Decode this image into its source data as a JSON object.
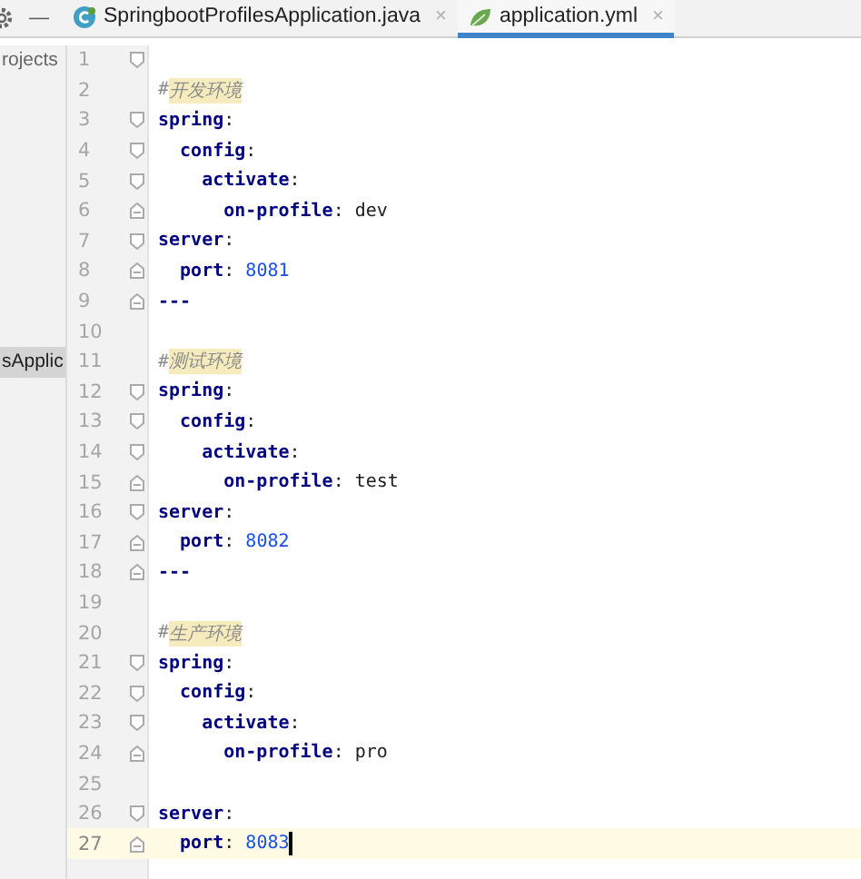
{
  "toolbar": {
    "minimize": "—"
  },
  "tabs": [
    {
      "label": "SpringbootProfilesApplication.java",
      "close": "×",
      "selected": false
    },
    {
      "label": "application.yml",
      "close": "×",
      "selected": true
    }
  ],
  "sidebar": {
    "items": [
      {
        "label": "rojects",
        "selected": false
      },
      {
        "label": "sApplic",
        "selected": true
      }
    ]
  },
  "editor": {
    "lines": [
      {
        "number": "1",
        "kind": "fold-start",
        "current": false
      },
      {
        "number": "2",
        "kind": "plain",
        "current": false,
        "tokens": [
          {
            "kind": "comment",
            "text": "#"
          },
          {
            "kind": "typo",
            "text": "开发环境"
          }
        ]
      },
      {
        "number": "3",
        "kind": "fold-start",
        "current": false,
        "tokens": [
          {
            "kind": "key",
            "text": "spring"
          },
          {
            "kind": "colon",
            "text": ":"
          }
        ]
      },
      {
        "number": "4",
        "kind": "fold-start",
        "current": false,
        "tokens": [
          {
            "kind": "key",
            "text": "  config"
          },
          {
            "kind": "colon",
            "text": ":"
          }
        ]
      },
      {
        "number": "5",
        "kind": "fold-start",
        "current": false,
        "tokens": [
          {
            "kind": "key",
            "text": "    activate"
          },
          {
            "kind": "colon",
            "text": ":"
          }
        ]
      },
      {
        "number": "6",
        "kind": "fold-end",
        "current": false,
        "tokens": [
          {
            "kind": "key",
            "text": "      on-profile"
          },
          {
            "kind": "colon",
            "text": ": "
          },
          {
            "kind": "value",
            "text": "dev"
          }
        ]
      },
      {
        "number": "7",
        "kind": "fold-start",
        "current": false,
        "tokens": [
          {
            "kind": "key",
            "text": "server"
          },
          {
            "kind": "colon",
            "text": ":"
          }
        ]
      },
      {
        "number": "8",
        "kind": "fold-end",
        "current": false,
        "tokens": [
          {
            "kind": "key",
            "text": "  port"
          },
          {
            "kind": "colon",
            "text": ": "
          },
          {
            "kind": "number",
            "text": "8081"
          }
        ]
      },
      {
        "number": "9",
        "kind": "fold-end",
        "current": false,
        "tokens": [
          {
            "kind": "doc",
            "text": "---"
          }
        ]
      },
      {
        "number": "10",
        "kind": "plain",
        "current": false
      },
      {
        "number": "11",
        "kind": "plain",
        "current": false,
        "tokens": [
          {
            "kind": "comment",
            "text": "#"
          },
          {
            "kind": "typo",
            "text": "测试环境"
          }
        ]
      },
      {
        "number": "12",
        "kind": "fold-start",
        "current": false,
        "tokens": [
          {
            "kind": "key",
            "text": "spring"
          },
          {
            "kind": "colon",
            "text": ":"
          }
        ]
      },
      {
        "number": "13",
        "kind": "fold-start",
        "current": false,
        "tokens": [
          {
            "kind": "key",
            "text": "  config"
          },
          {
            "kind": "colon",
            "text": ":"
          }
        ]
      },
      {
        "number": "14",
        "kind": "fold-start",
        "current": false,
        "tokens": [
          {
            "kind": "key",
            "text": "    activate"
          },
          {
            "kind": "colon",
            "text": ":"
          }
        ]
      },
      {
        "number": "15",
        "kind": "fold-end",
        "current": false,
        "tokens": [
          {
            "kind": "key",
            "text": "      on-profile"
          },
          {
            "kind": "colon",
            "text": ": "
          },
          {
            "kind": "value",
            "text": "test"
          }
        ]
      },
      {
        "number": "16",
        "kind": "fold-start",
        "current": false,
        "tokens": [
          {
            "kind": "key",
            "text": "server"
          },
          {
            "kind": "colon",
            "text": ":"
          }
        ]
      },
      {
        "number": "17",
        "kind": "fold-end",
        "current": false,
        "tokens": [
          {
            "kind": "key",
            "text": "  port"
          },
          {
            "kind": "colon",
            "text": ": "
          },
          {
            "kind": "number",
            "text": "8082"
          }
        ]
      },
      {
        "number": "18",
        "kind": "fold-end",
        "current": false,
        "tokens": [
          {
            "kind": "doc",
            "text": "---"
          }
        ]
      },
      {
        "number": "19",
        "kind": "plain",
        "current": false
      },
      {
        "number": "20",
        "kind": "plain",
        "current": false,
        "tokens": [
          {
            "kind": "comment",
            "text": "#"
          },
          {
            "kind": "typo",
            "text": "生产环境"
          }
        ]
      },
      {
        "number": "21",
        "kind": "fold-start",
        "current": false,
        "tokens": [
          {
            "kind": "key",
            "text": "spring"
          },
          {
            "kind": "colon",
            "text": ":"
          }
        ]
      },
      {
        "number": "22",
        "kind": "fold-start",
        "current": false,
        "tokens": [
          {
            "kind": "key",
            "text": "  config"
          },
          {
            "kind": "colon",
            "text": ":"
          }
        ]
      },
      {
        "number": "23",
        "kind": "fold-start",
        "current": false,
        "tokens": [
          {
            "kind": "key",
            "text": "    activate"
          },
          {
            "kind": "colon",
            "text": ":"
          }
        ]
      },
      {
        "number": "24",
        "kind": "fold-end",
        "current": false,
        "tokens": [
          {
            "kind": "key",
            "text": "      on-profile"
          },
          {
            "kind": "colon",
            "text": ": "
          },
          {
            "kind": "value",
            "text": "pro"
          }
        ]
      },
      {
        "number": "25",
        "kind": "plain",
        "current": false
      },
      {
        "number": "26",
        "kind": "fold-start",
        "current": false,
        "tokens": [
          {
            "kind": "key",
            "text": "server"
          },
          {
            "kind": "colon",
            "text": ":"
          }
        ]
      },
      {
        "number": "27",
        "kind": "fold-end",
        "current": true,
        "tokens": [
          {
            "kind": "key",
            "text": "  port"
          },
          {
            "kind": "colon",
            "text": ": "
          },
          {
            "kind": "number",
            "text": "8083"
          }
        ]
      }
    ]
  }
}
